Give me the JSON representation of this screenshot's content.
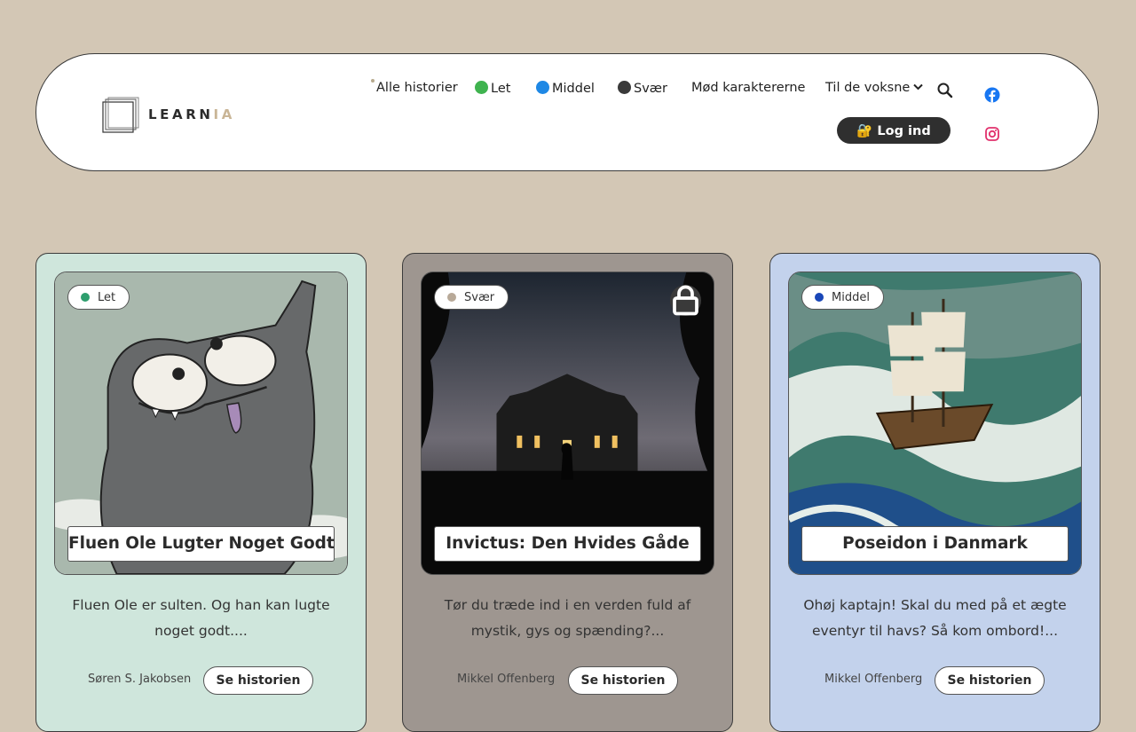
{
  "brand": {
    "name_main": "LEARN",
    "name_accent": "IA"
  },
  "nav": {
    "items": [
      {
        "label": "Alle historier"
      },
      {
        "label": "Let",
        "dot_color": "#3fb34f"
      },
      {
        "label": "Middel",
        "dot_color": "#1e88e5"
      },
      {
        "label": "Svær",
        "dot_color": "#3a3a3a"
      },
      {
        "label": "Mød karaktererne"
      },
      {
        "label": "Til de voksne"
      }
    ],
    "login_label": "🔐 Log ind",
    "search_icon": "search-icon",
    "social": [
      "facebook-icon",
      "instagram-icon"
    ]
  },
  "colors": {
    "background": "#d3c7b5",
    "easy_card": "#cfe6dc",
    "hard_card": "#9e9690",
    "medium_card": "#c3d2ec",
    "facebook": "#1877f2",
    "instagram": "#e1306c"
  },
  "cards": [
    {
      "level": "Let",
      "level_color": "#2e9e6e",
      "title": "Fluen Ole Lugter Noget Godt",
      "description": "Fluen Ole er sulten. Og han kan lugte noget godt....",
      "author": "Søren S. Jakobsen",
      "button": "Se historien",
      "locked": false
    },
    {
      "level": "Svær",
      "level_color": "#b8a998",
      "title": "Invictus: Den Hvides Gåde",
      "description": "Tør du træde ind i en verden fuld af mystik, gys og spænding?...",
      "author": "Mikkel Offenberg",
      "button": "Se historien",
      "locked": true
    },
    {
      "level": "Middel",
      "level_color": "#1a47b8",
      "title": "Poseidon i Danmark",
      "description": "Ohøj kaptajn! Skal du med på et ægte eventyr til havs? Så kom ombord!...",
      "author": "Mikkel Offenberg",
      "button": "Se historien",
      "locked": false
    }
  ]
}
